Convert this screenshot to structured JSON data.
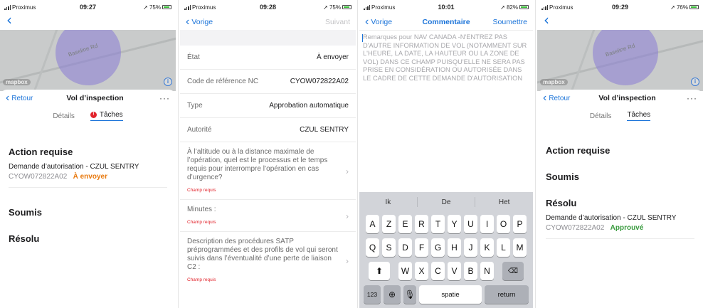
{
  "colors": {
    "accent": "#1a73d9",
    "orange": "#e8790e",
    "green": "#3a9b3f",
    "red": "#e2232b"
  },
  "screen1": {
    "status": {
      "carrier": "Proximus",
      "time": "09:27",
      "battery": "75%"
    },
    "map": {
      "road_label": "Baseline Rd",
      "logo": "mapbox"
    },
    "header": {
      "back": "Retour",
      "title": "Vol d’inspection",
      "more": "···"
    },
    "tabs": {
      "details": "Détails",
      "tasks": "Tâches",
      "badge": "!"
    },
    "action_required": "Action requise",
    "task": {
      "title": "Demande d’autorisation  -  CZUL SENTRY",
      "code": "CYOW072822A02",
      "status": "À envoyer"
    },
    "submitted": "Soumis",
    "resolved": "Résolu"
  },
  "screen2": {
    "status": {
      "carrier": "Proximus",
      "time": "09:28",
      "battery": "75%"
    },
    "nav": {
      "back": "Vorige",
      "next": "Suivant"
    },
    "rows": [
      {
        "label": "État",
        "value": "À envoyer"
      },
      {
        "label": "Code de référence NC",
        "value": "CYOW072822A02"
      },
      {
        "label": "Type",
        "value": "Approbation automatique"
      },
      {
        "label": "Autorité",
        "value": "CZUL SENTRY"
      }
    ],
    "questions": [
      {
        "text": "À l’altitude ou à la distance maximale de l’opération, quel est le processus et le temps requis pour interrompre l’opération en cas d’urgence?",
        "required": "Champ requis"
      },
      {
        "text": "Minutes :",
        "required": "Champ requis"
      },
      {
        "text": "Description des procédures SATP préprogrammées et des profils de vol qui seront suivis dans l’éventualité d’une perte de liaison C2 :",
        "required": "Champ requis"
      }
    ]
  },
  "screen3": {
    "status": {
      "carrier": "Proximus",
      "time": "10:01",
      "battery": "82%"
    },
    "nav": {
      "back": "Vorige",
      "title": "Commentaire",
      "submit": "Soumettre"
    },
    "placeholder": "Remarques pour NAV CANADA  -N'ENTREZ PAS D'AUTRE INFORMATION DE VOL (NOTAMMENT SUR L'HEURE, LA DATE, LA HAUTEUR OU LA ZONE DE VOL) DANS CE CHAMP PUISQU'ELLE NE SERA PAS PRISE EN CONSIDÉRATION OU AUTORISÉE DANS LE CADRE DE CETTE DEMANDE D'AUTORISATION",
    "keyboard": {
      "suggestions": [
        "Ik",
        "De",
        "Het"
      ],
      "row1": [
        "A",
        "Z",
        "E",
        "R",
        "T",
        "Y",
        "U",
        "I",
        "O",
        "P"
      ],
      "row2": [
        "Q",
        "S",
        "D",
        "F",
        "G",
        "H",
        "J",
        "K",
        "L",
        "M"
      ],
      "row3": [
        "W",
        "X",
        "C",
        "V",
        "B",
        "N"
      ],
      "numbers": "123",
      "space": "spatie",
      "return": "return"
    }
  },
  "screen4": {
    "status": {
      "carrier": "Proximus",
      "time": "09:29",
      "battery": "76%"
    },
    "map": {
      "road_label": "Baseline Rd",
      "logo": "mapbox"
    },
    "header": {
      "back": "Retour",
      "title": "Vol d’inspection",
      "more": "···"
    },
    "tabs": {
      "details": "Détails",
      "tasks": "Tâches"
    },
    "action_required": "Action requise",
    "submitted": "Soumis",
    "resolved": "Résolu",
    "task": {
      "title": "Demande d’autorisation  -  CZUL SENTRY",
      "code": "CYOW072822A02",
      "status": "Approuvé"
    }
  }
}
